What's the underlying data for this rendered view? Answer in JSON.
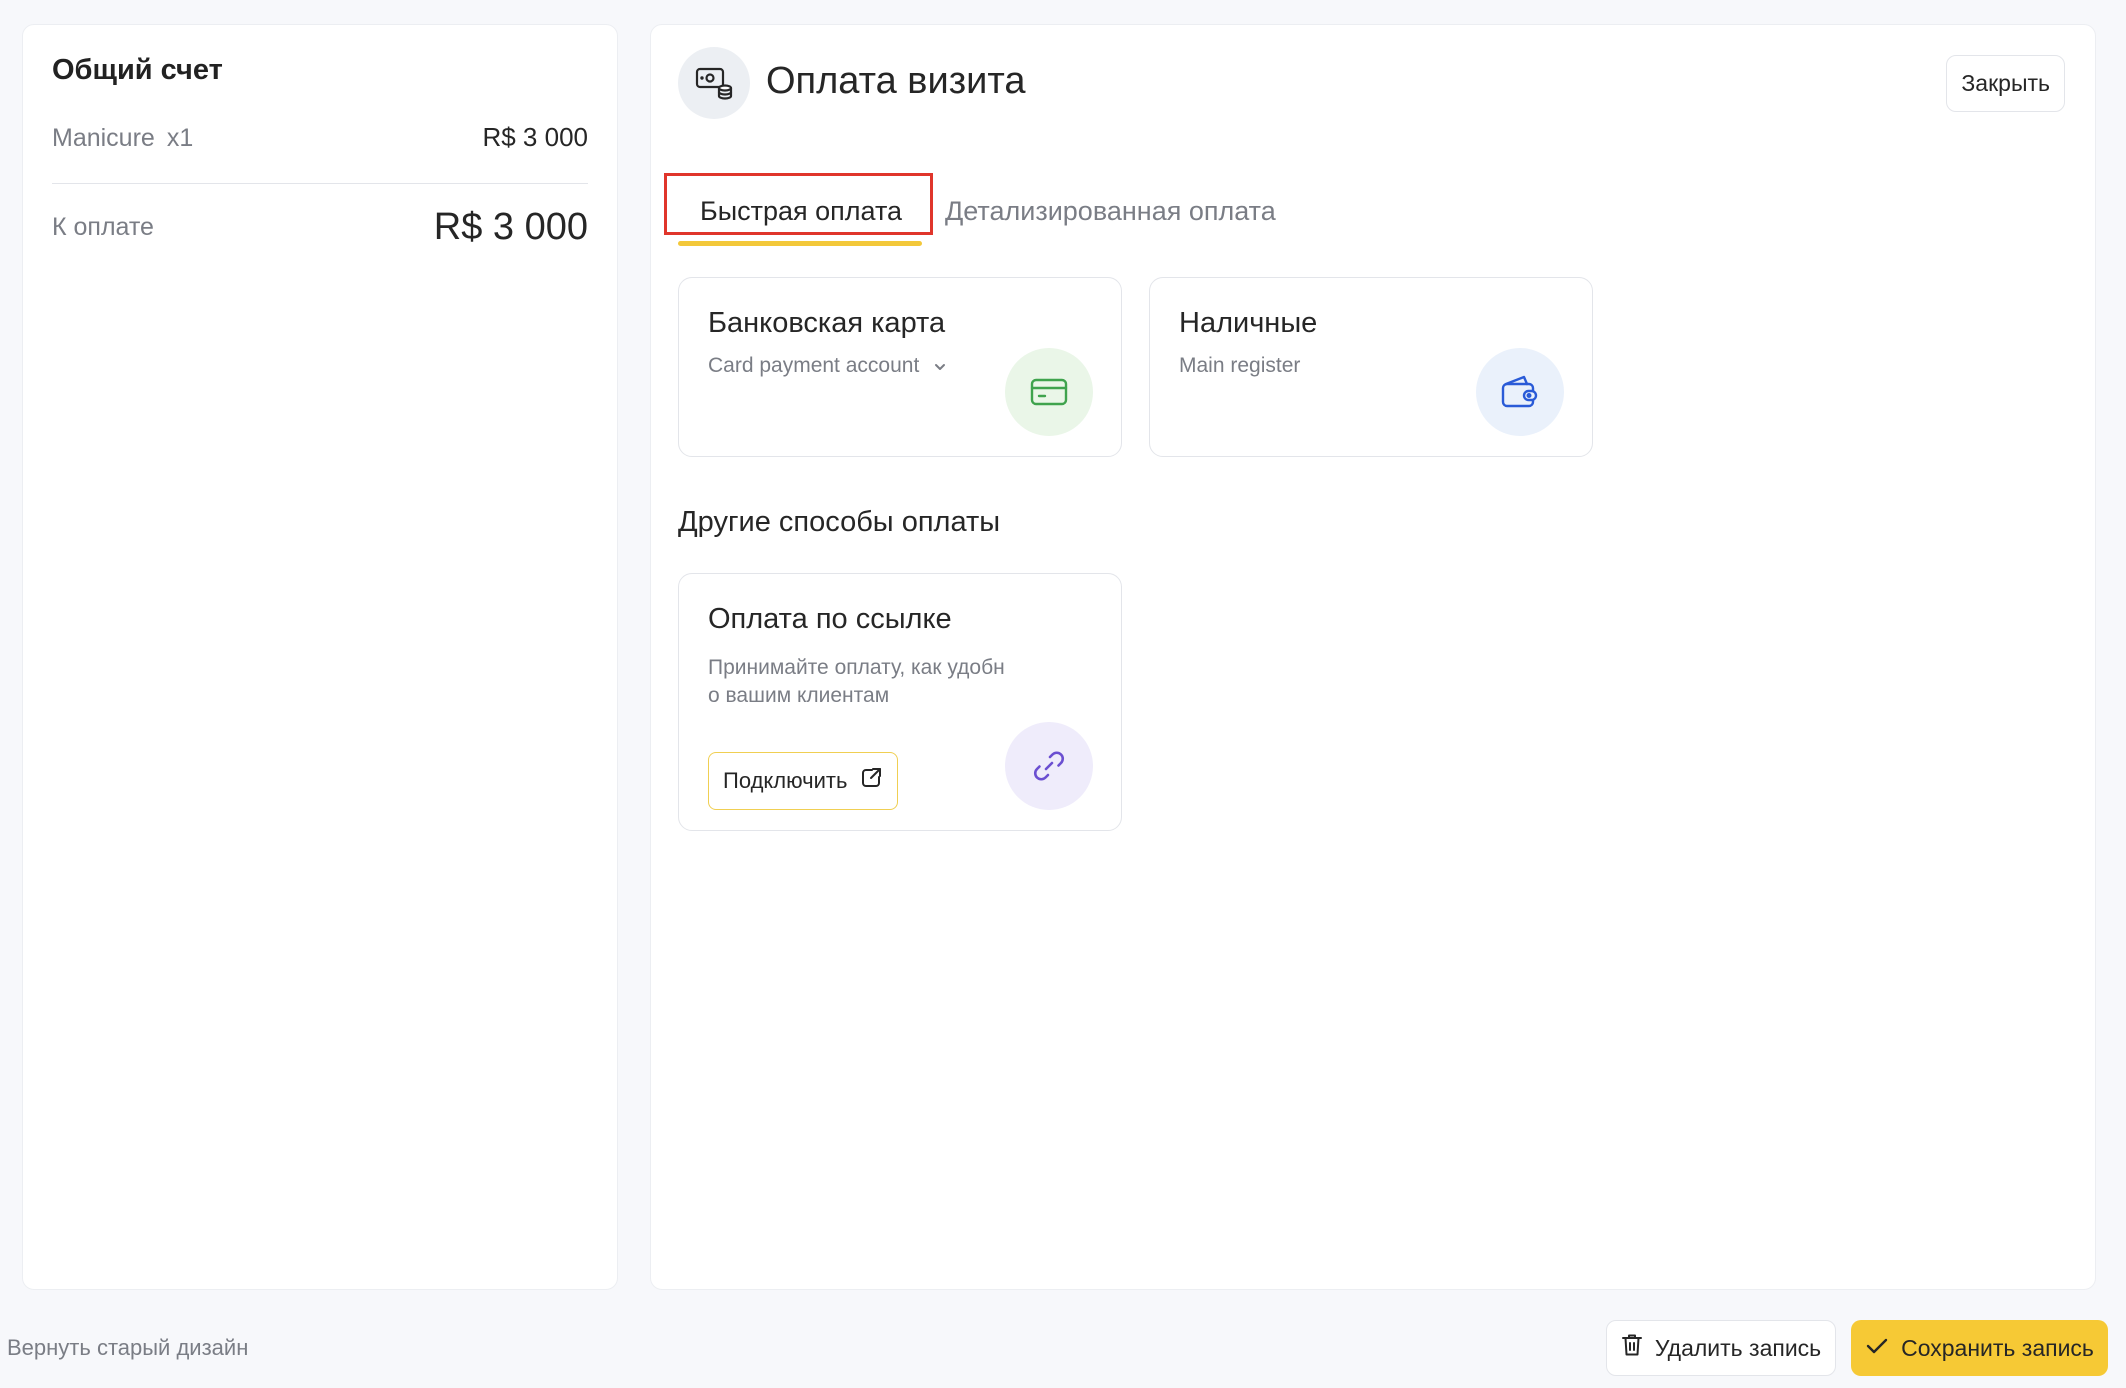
{
  "summary": {
    "title": "Общий счет",
    "item_name": "Manicure",
    "item_qty": "x1",
    "item_price": "R$ 3 000",
    "total_label": "К оплате",
    "total_value": "R$ 3 000"
  },
  "header": {
    "title": "Оплата визита",
    "close_label": "Закрыть"
  },
  "tabs": [
    {
      "label": "Быстрая оплата",
      "active": true
    },
    {
      "label": "Детализированная оплата",
      "active": false
    }
  ],
  "payment_methods": [
    {
      "title": "Банковская карта",
      "subtitle": "Card payment account",
      "icon": "credit-card-icon",
      "icon_bg": "#eaf6e8",
      "icon_color": "#3fa34d"
    },
    {
      "title": "Наличные",
      "subtitle": "Main register",
      "icon": "wallet-icon",
      "icon_bg": "#eaf1fb",
      "icon_color": "#2a5bd7"
    }
  ],
  "other_methods": {
    "title": "Другие способы оплаты",
    "items": [
      {
        "title": "Оплата по ссылке",
        "description": "Принимайте оплату, как удобно вашим клиентам",
        "button_label": "Подключить",
        "icon": "link-icon",
        "icon_bg": "#efecfb",
        "icon_color": "#6b4fd1"
      }
    ]
  },
  "footer": {
    "old_design_label": "Вернуть старый дизайн",
    "delete_label": "Удалить запись",
    "save_label": "Сохранить запись"
  },
  "colors": {
    "accent": "#f6c935",
    "tab_underline": "#f3c83a",
    "highlight_box": "#e0352b"
  }
}
